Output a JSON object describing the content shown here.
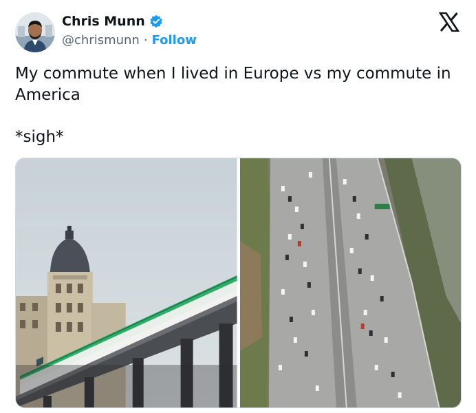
{
  "author": {
    "name": "Chris Munn",
    "handle": "@chrismunn",
    "separator": "·",
    "follow_label": "Follow"
  },
  "tweet": {
    "line1": "My commute when I lived in Europe vs my commute in America",
    "line2": "*sigh*"
  },
  "icons": {
    "verified": "verified-badge-icon",
    "brand": "x-logo-icon"
  },
  "media": {
    "left": "photo-elevated-metro-train-paris",
    "right": "photo-congested-multilane-freeway"
  },
  "colors": {
    "accent": "#1d9bf0",
    "text": "#0f1419",
    "muted": "#536471",
    "train_green": "#2fae6b"
  }
}
